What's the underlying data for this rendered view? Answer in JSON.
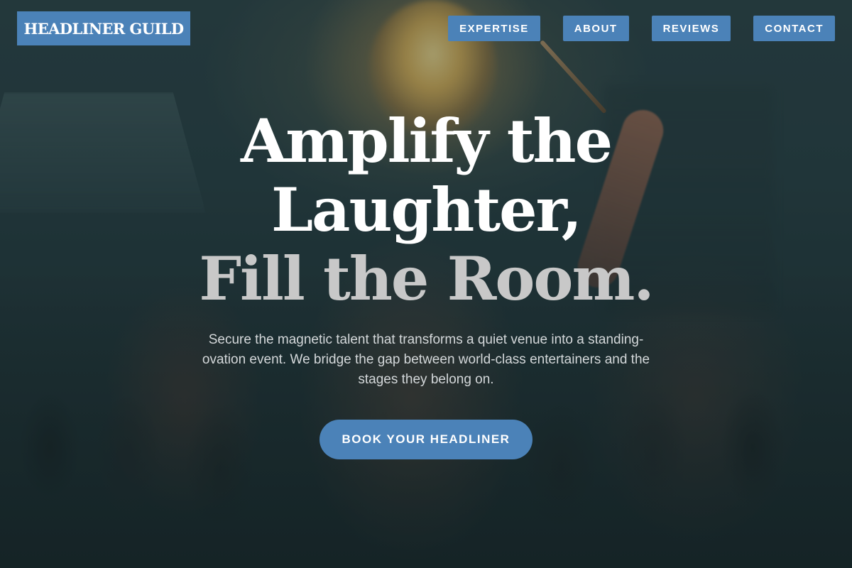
{
  "brand": {
    "logo_text": "HEADLINER GUILD"
  },
  "nav": {
    "items": [
      {
        "label": "EXPERTISE"
      },
      {
        "label": "ABOUT"
      },
      {
        "label": "REVIEWS"
      },
      {
        "label": "CONTACT"
      }
    ]
  },
  "hero": {
    "headline_line1": "Amplify the",
    "headline_line2": "Laughter,",
    "headline_line3": "Fill the Room.",
    "subtext": "Secure the magnetic talent that transforms a quiet venue into a standing-ovation event. We bridge the gap between world-class entertainers and the stages they belong on.",
    "cta_label": "BOOK YOUR HEADLINER"
  },
  "colors": {
    "accent": "#4b82b8",
    "headline": "#ffffff",
    "headline_accent": "#c8c8c8",
    "overlay": "#1f3033"
  }
}
